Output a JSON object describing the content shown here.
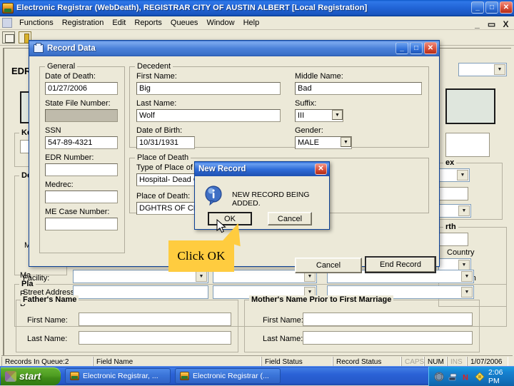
{
  "app": {
    "title": "Electronic Registrar (WebDeath), REGISTRAR   CITY OF AUSTIN   ALBERT   [Local Registration]",
    "title_icon": "app-icon",
    "window_buttons": {
      "minimize": "_",
      "restore": "□",
      "close": "✕"
    },
    "mdi_buttons": {
      "minimize": "_",
      "restore": "▭",
      "close": "X"
    }
  },
  "menubar": {
    "items": [
      {
        "label": "Functions"
      },
      {
        "label": "Registration"
      },
      {
        "label": "Edit"
      },
      {
        "label": "Reports"
      },
      {
        "label": "Queues"
      },
      {
        "label": "Window"
      },
      {
        "label": "Help"
      }
    ]
  },
  "background_form": {
    "edr_label": "EDR #",
    "group_titles": {
      "key": "Key",
      "dec": "Dec",
      "place": "Pla",
      "sex": "ex",
      "birth": "rth"
    },
    "captions": {
      "facility": "Facility:",
      "street_address": "Street Address:",
      "country": "Country",
      "city_of_birth": "City of Birth",
      "m1": "M",
      "m2": "Ma",
      "p1": "P",
      "p2": "D"
    },
    "fathers_name": {
      "group_title": "Father's Name",
      "first_label": "First Name:",
      "first_value": "",
      "last_label": "Last Name:",
      "last_value": ""
    },
    "mothers_name": {
      "group_title": "Mother's Name Prior to First Marriage",
      "first_label": "First Name:",
      "first_value": "",
      "last_label": "Last Name:",
      "last_value": ""
    }
  },
  "statusbar": {
    "records_in_queue": "Records In Queue:2",
    "field_name": "Field Name",
    "field_status": "Field Status",
    "record_status": "Record Status",
    "caps": "CAPS",
    "num": "NUM",
    "ins": "INS",
    "date": "1/07/2006"
  },
  "record_dialog": {
    "title": "Record Data",
    "title_icon": "window-icon",
    "window_buttons": {
      "minimize": "_",
      "maximize": "□",
      "close": "✕"
    },
    "general": {
      "group_title": "General",
      "fields": [
        {
          "label": "Date of Death:",
          "value": "01/27/2006",
          "disabled": false
        },
        {
          "label": "State File Number:",
          "value": "",
          "disabled": true
        },
        {
          "label": "SSN",
          "value": "547-89-4321",
          "disabled": false
        },
        {
          "label": "EDR Number:",
          "value": "",
          "disabled": false
        },
        {
          "label": "Medrec:",
          "value": "",
          "disabled": false
        },
        {
          "label": "ME Case Number:",
          "value": "",
          "disabled": false
        }
      ]
    },
    "decedent": {
      "group_title": "Decedent",
      "first_name_label": "First Name:",
      "first_name_value": "Big",
      "middle_name_label": "Middle Name:",
      "middle_name_value": "Bad",
      "last_name_label": "Last Name:",
      "last_name_value": "Wolf",
      "suffix_label": "Suffix:",
      "suffix_value": "III",
      "dob_label": "Date of Birth:",
      "dob_value": "10/31/1931",
      "gender_label": "Gender:",
      "gender_value": "MALE"
    },
    "place_of_death": {
      "group_title": "Place of Death",
      "type_label": "Type of Place of Death:",
      "type_value": "Hospital- Dead On Arrival",
      "place_label": "Place of Death:",
      "place_value": "DGHTRS OF CHTY HLT"
    },
    "buttons": {
      "cancel": "Cancel",
      "end_record": "End Record"
    }
  },
  "new_record_modal": {
    "title": "New Record",
    "close_label": "✕",
    "icon": "info-icon",
    "message": "NEW RECORD BEING ADDED.",
    "ok_label": "OK",
    "cancel_label": "Cancel"
  },
  "callout": {
    "text": "Click OK",
    "color": "#ffcc3f"
  },
  "taskbar": {
    "start_label": "start",
    "tasks": [
      {
        "label": "Electronic Registrar, ..."
      },
      {
        "label": "Electronic Registrar (..."
      }
    ],
    "tray_icons": [
      "shield-icon",
      "network-icon",
      "norton-icon",
      "update-icon"
    ],
    "clock": "2:06 PM"
  },
  "colors": {
    "titlebar_blue": "#2164d6",
    "dialog_blue": "#4b81d9",
    "face": "#ece9d8",
    "callout_yellow": "#ffcc3f",
    "taskbar_blue": "#2458c8",
    "start_green": "#4f9e22"
  }
}
